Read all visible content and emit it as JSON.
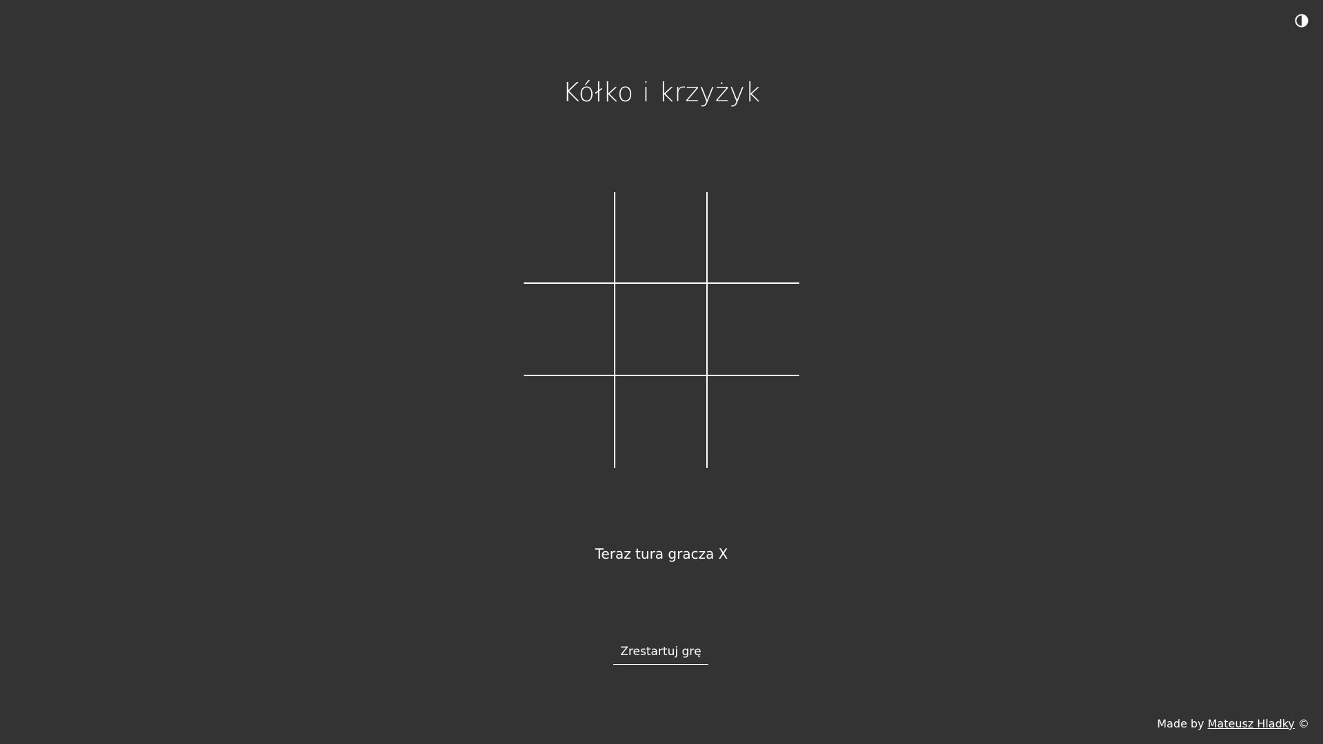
{
  "header": {
    "title": "Kółko i krzyżyk",
    "theme_toggle_icon": "contrast-icon"
  },
  "board": {
    "cells": [
      "",
      "",
      "",
      "",
      "",
      "",
      "",
      "",
      ""
    ]
  },
  "status": {
    "text": "Teraz tura gracza X"
  },
  "controls": {
    "restart_label": "Zrestartuj grę"
  },
  "footer": {
    "prefix": "Made by ",
    "author": "Mateusz Hladky",
    "suffix": " ©"
  },
  "colors": {
    "background": "#333333",
    "foreground": "#ffffff"
  }
}
